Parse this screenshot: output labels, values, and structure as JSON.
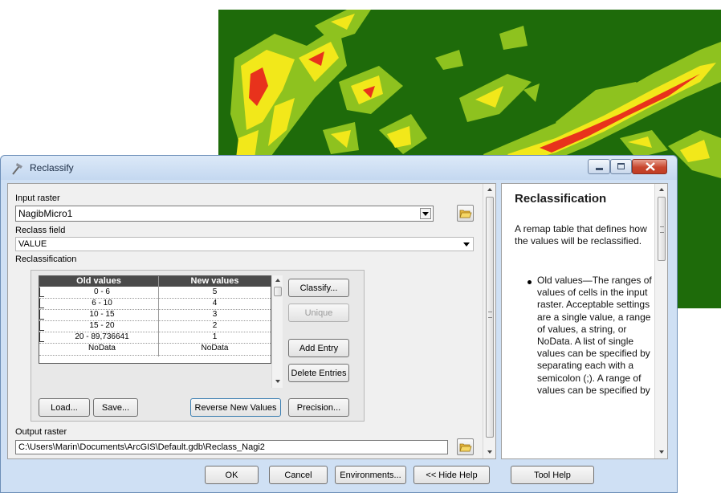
{
  "dialog": {
    "title": "Reclassify",
    "input_raster_label": "Input raster",
    "input_raster_value": "NagibMicro1",
    "reclass_field_label": "Reclass field",
    "reclass_field_value": "VALUE",
    "reclassification_label": "Reclassification",
    "table": {
      "headers": [
        "Old values",
        "New values"
      ],
      "rows": [
        [
          "0 - 6",
          "5"
        ],
        [
          "6 - 10",
          "4"
        ],
        [
          "10 - 15",
          "3"
        ],
        [
          "15 - 20",
          "2"
        ],
        [
          "20 - 89,736641",
          "1"
        ],
        [
          "NoData",
          "NoData"
        ]
      ]
    },
    "buttons": {
      "classify": "Classify...",
      "unique": "Unique",
      "add_entry": "Add Entry",
      "delete_entries": "Delete Entries",
      "load": "Load...",
      "save": "Save...",
      "reverse": "Reverse New Values",
      "precision": "Precision..."
    },
    "output_raster_label": "Output raster",
    "output_raster_value": "C:\\Users\\Marin\\Documents\\ArcGIS\\Default.gdb\\Reclass_Nagi2"
  },
  "help": {
    "title": "Reclassification",
    "intro": "A remap table that defines how the values will be reclassified.",
    "bullet": "Old values—The ranges of values of cells in the input raster. Acceptable settings are a single value, a range of values, a string, or NoData. A list of single values can be specified by separating each with a semicolon (;). A range of values can be specified by"
  },
  "footer": {
    "ok": "OK",
    "cancel": "Cancel",
    "environments": "Environments...",
    "hide_help": "<< Hide Help",
    "tool_help": "Tool Help"
  },
  "colors": {
    "map_background": "#1e6b0a",
    "map_light_green": "#8ec21f",
    "map_yellow": "#f2e81a",
    "map_red": "#e8321c",
    "dialog_frame": "#cfe0f4",
    "table_header": "#4a4a4a"
  },
  "icons": [
    "reclassify-hammer-icon",
    "minimize-icon",
    "maximize-icon",
    "close-icon",
    "folder-open-icon",
    "chevron-down-icon"
  ]
}
